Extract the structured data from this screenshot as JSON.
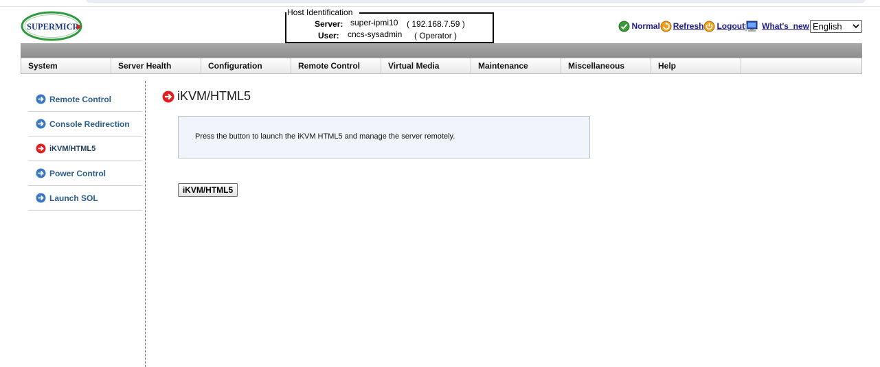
{
  "brand": {
    "logo_text": "SUPERMICR"
  },
  "host": {
    "title": "Host Identification",
    "server_label": "Server:",
    "server_name": "super-ipmi10",
    "server_ip": "( 192.168.7.59 )",
    "user_label": "User:",
    "user_name": "cncs-sysadmin",
    "user_role": "( Operator )"
  },
  "status": {
    "normal_label": "Normal",
    "refresh_label": "Refresh",
    "logout_label": "Logout",
    "whats_new_label": "What's_new",
    "language_selected": "English",
    "icons": [
      "check-circle-icon",
      "refresh-icon",
      "logout-icon",
      "monitor-icon"
    ],
    "colors": {
      "link": "#1a1a8c",
      "status_ok": "#3a9a3a"
    }
  },
  "menu": {
    "items": [
      {
        "label": "System"
      },
      {
        "label": "Server Health"
      },
      {
        "label": "Configuration"
      },
      {
        "label": "Remote Control"
      },
      {
        "label": "Virtual Media"
      },
      {
        "label": "Maintenance"
      },
      {
        "label": "Miscellaneous"
      },
      {
        "label": "Help"
      },
      {
        "label": ""
      }
    ]
  },
  "sidebar": {
    "items": [
      {
        "label": "Remote Control",
        "active": false
      },
      {
        "label": "Console Redirection",
        "active": false
      },
      {
        "label": "iKVM/HTML5",
        "active": true
      },
      {
        "label": "Power Control",
        "active": false
      },
      {
        "label": "Launch SOL",
        "active": false
      }
    ],
    "colors": {
      "arrow_blue": "#3a78c2",
      "arrow_red": "#e02020",
      "text": "#2b5c8a"
    }
  },
  "main": {
    "title": "iKVM/HTML5",
    "info_text": "Press the button to launch the iKVM HTML5 and manage the server remotely.",
    "launch_button_label": "iKVM/HTML5"
  }
}
